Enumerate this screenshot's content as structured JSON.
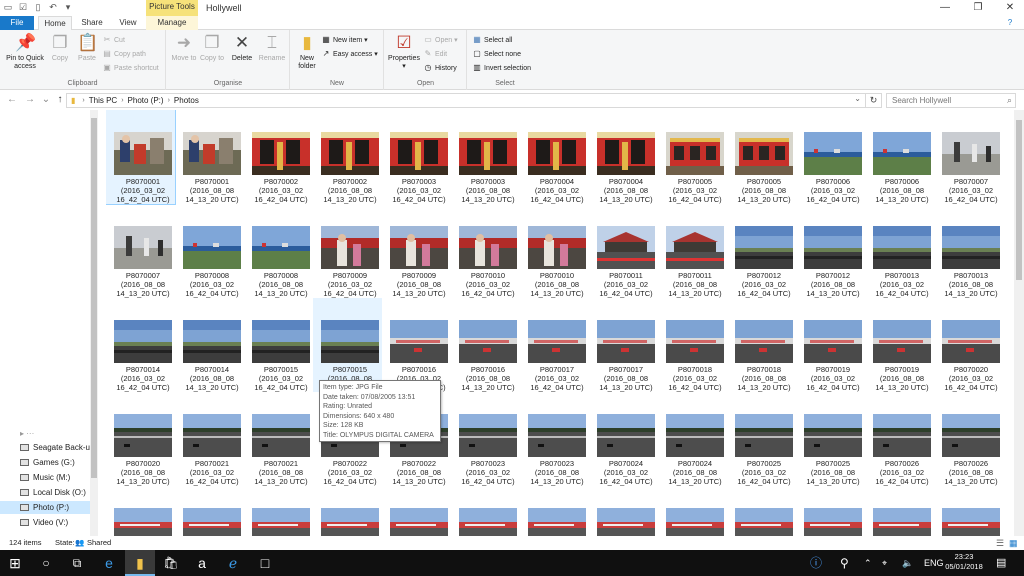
{
  "window": {
    "title": "Hollywell",
    "context_tab": "Picture Tools"
  },
  "tabs": {
    "file": "File",
    "home": "Home",
    "share": "Share",
    "view": "View",
    "manage": "Manage"
  },
  "ribbon": {
    "clipboard": {
      "label": "Clipboard",
      "pin": "Pin to Quick access",
      "copy": "Copy",
      "paste": "Paste",
      "cut": "Cut",
      "copy_path": "Copy path",
      "paste_shortcut": "Paste shortcut"
    },
    "organise": {
      "label": "Organise",
      "move_to": "Move to",
      "copy_to": "Copy to",
      "delete": "Delete",
      "rename": "Rename"
    },
    "new": {
      "label": "New",
      "new_folder": "New folder",
      "new_item": "New item",
      "easy_access": "Easy access"
    },
    "open": {
      "label": "Open",
      "properties": "Properties",
      "open": "Open",
      "edit": "Edit",
      "history": "History"
    },
    "select": {
      "label": "Select",
      "select_all": "Select all",
      "select_none": "Select none",
      "invert": "Invert selection"
    }
  },
  "address": {
    "crumbs": [
      "This PC",
      "Photo (P:)",
      "Photos"
    ],
    "search_placeholder": "Search Hollywell"
  },
  "nav": {
    "items": [
      "Seagate Back-up",
      "Games (G:)",
      "Music (M:)",
      "Local Disk (O:)",
      "Photo (P:)",
      "Video (V:)"
    ],
    "selected": 4
  },
  "files": [
    {
      "n": "P8070001",
      "d": "(2016_03_02",
      "t": "16_42_04 UTC)",
      "img": "a"
    },
    {
      "n": "P8070001",
      "d": "(2016_08_08",
      "t": "14_13_20 UTC)",
      "img": "a"
    },
    {
      "n": "P8070002",
      "d": "(2016_03_02",
      "t": "16_42_04 UTC)",
      "img": "b"
    },
    {
      "n": "P8070002",
      "d": "(2016_08_08",
      "t": "14_13_20 UTC)",
      "img": "b"
    },
    {
      "n": "P8070003",
      "d": "(2016_03_02",
      "t": "16_42_04 UTC)",
      "img": "b"
    },
    {
      "n": "P8070003",
      "d": "(2016_08_08",
      "t": "14_13_20 UTC)",
      "img": "b"
    },
    {
      "n": "P8070004",
      "d": "(2016_03_02",
      "t": "16_42_04 UTC)",
      "img": "b"
    },
    {
      "n": "P8070004",
      "d": "(2016_08_08",
      "t": "14_13_20 UTC)",
      "img": "b"
    },
    {
      "n": "P8070005",
      "d": "(2016_03_02",
      "t": "16_42_04 UTC)",
      "img": "c"
    },
    {
      "n": "P8070005",
      "d": "(2016_08_08",
      "t": "14_13_20 UTC)",
      "img": "c"
    },
    {
      "n": "P8070006",
      "d": "(2016_03_02",
      "t": "16_42_04 UTC)",
      "img": "d"
    },
    {
      "n": "P8070006",
      "d": "(2016_08_08",
      "t": "14_13_20 UTC)",
      "img": "d"
    },
    {
      "n": "P8070007",
      "d": "(2016_03_02",
      "t": "16_42_04 UTC)",
      "img": "e"
    },
    {
      "n": "P8070007",
      "d": "(2016_08_08",
      "t": "14_13_20 UTC)",
      "img": "e"
    },
    {
      "n": "P8070008",
      "d": "(2016_03_02",
      "t": "16_42_04 UTC)",
      "img": "d"
    },
    {
      "n": "P8070008",
      "d": "(2016_08_08",
      "t": "14_13_20 UTC)",
      "img": "d"
    },
    {
      "n": "P8070009",
      "d": "(2016_03_02",
      "t": "16_42_04 UTC)",
      "img": "f"
    },
    {
      "n": "P8070009",
      "d": "(2016_08_08",
      "t": "14_13_20 UTC)",
      "img": "f"
    },
    {
      "n": "P8070010",
      "d": "(2016_03_02",
      "t": "16_42_04 UTC)",
      "img": "f"
    },
    {
      "n": "P8070010",
      "d": "(2016_08_08",
      "t": "14_13_20 UTC)",
      "img": "f"
    },
    {
      "n": "P8070011",
      "d": "(2016_03_02",
      "t": "16_42_04 UTC)",
      "img": "g"
    },
    {
      "n": "P8070011",
      "d": "(2016_08_08",
      "t": "14_13_20 UTC)",
      "img": "g"
    },
    {
      "n": "P8070012",
      "d": "(2016_03_02",
      "t": "16_42_04 UTC)",
      "img": "h"
    },
    {
      "n": "P8070012",
      "d": "(2016_08_08",
      "t": "14_13_20 UTC)",
      "img": "h"
    },
    {
      "n": "P8070013",
      "d": "(2016_03_02",
      "t": "16_42_04 UTC)",
      "img": "h"
    },
    {
      "n": "P8070013",
      "d": "(2016_08_08",
      "t": "14_13_20 UTC)",
      "img": "h"
    },
    {
      "n": "P8070014",
      "d": "(2016_03_02",
      "t": "16_42_04 UTC)",
      "img": "h"
    },
    {
      "n": "P8070014",
      "d": "(2016_08_08",
      "t": "14_13_20 UTC)",
      "img": "h"
    },
    {
      "n": "P8070015",
      "d": "(2016_03_02",
      "t": "16_42_04 UTC)",
      "img": "h"
    },
    {
      "n": "P8070015",
      "d": "(2016_08_08",
      "t": "14_13_20 UTC)",
      "img": "h"
    },
    {
      "n": "P8070016",
      "d": "(2016_03_02",
      "t": "16_42_04 UTC)",
      "img": "i"
    },
    {
      "n": "P8070016",
      "d": "(2016_08_08",
      "t": "14_13_20 UTC)",
      "img": "i"
    },
    {
      "n": "P8070017",
      "d": "(2016_03_02",
      "t": "16_42_04 UTC)",
      "img": "i"
    },
    {
      "n": "P8070017",
      "d": "(2016_08_08",
      "t": "14_13_20 UTC)",
      "img": "i"
    },
    {
      "n": "P8070018",
      "d": "(2016_03_02",
      "t": "16_42_04 UTC)",
      "img": "i"
    },
    {
      "n": "P8070018",
      "d": "(2016_08_08",
      "t": "14_13_20 UTC)",
      "img": "i"
    },
    {
      "n": "P8070019",
      "d": "(2016_03_02",
      "t": "16_42_04 UTC)",
      "img": "i"
    },
    {
      "n": "P8070019",
      "d": "(2016_08_08",
      "t": "14_13_20 UTC)",
      "img": "i"
    },
    {
      "n": "P8070020",
      "d": "(2016_03_02",
      "t": "16_42_04 UTC)",
      "img": "i"
    },
    {
      "n": "P8070020",
      "d": "(2016_08_08",
      "t": "14_13_20 UTC)",
      "img": "j"
    },
    {
      "n": "P8070021",
      "d": "(2016_03_02",
      "t": "16_42_04 UTC)",
      "img": "j"
    },
    {
      "n": "P8070021",
      "d": "(2016_08_08",
      "t": "14_13_20 UTC)",
      "img": "j"
    },
    {
      "n": "P8070022",
      "d": "(2016_03_02",
      "t": "16_42_04 UTC)",
      "img": "j"
    },
    {
      "n": "P8070022",
      "d": "(2016_08_08",
      "t": "14_13_20 UTC)",
      "img": "j"
    },
    {
      "n": "P8070023",
      "d": "(2016_03_02",
      "t": "16_42_04 UTC)",
      "img": "j"
    },
    {
      "n": "P8070023",
      "d": "(2016_08_08",
      "t": "14_13_20 UTC)",
      "img": "j"
    },
    {
      "n": "P8070024",
      "d": "(2016_03_02",
      "t": "16_42_04 UTC)",
      "img": "j"
    },
    {
      "n": "P8070024",
      "d": "(2016_08_08",
      "t": "14_13_20 UTC)",
      "img": "j"
    },
    {
      "n": "P8070025",
      "d": "(2016_03_02",
      "t": "16_42_04 UTC)",
      "img": "j"
    },
    {
      "n": "P8070025",
      "d": "(2016_08_08",
      "t": "14_13_20 UTC)",
      "img": "j"
    },
    {
      "n": "P8070026",
      "d": "(2016_03_02",
      "t": "16_42_04 UTC)",
      "img": "j"
    },
    {
      "n": "P8070026",
      "d": "(2016_08_08",
      "t": "14_13_20 UTC)",
      "img": "j"
    },
    {
      "n": "",
      "d": "",
      "t": "",
      "img": "k"
    },
    {
      "n": "",
      "d": "",
      "t": "",
      "img": "k"
    },
    {
      "n": "",
      "d": "",
      "t": "",
      "img": "k"
    },
    {
      "n": "",
      "d": "",
      "t": "",
      "img": "k"
    },
    {
      "n": "",
      "d": "",
      "t": "",
      "img": "k"
    },
    {
      "n": "",
      "d": "",
      "t": "",
      "img": "k"
    },
    {
      "n": "",
      "d": "",
      "t": "",
      "img": "k"
    },
    {
      "n": "",
      "d": "",
      "t": "",
      "img": "k"
    },
    {
      "n": "",
      "d": "",
      "t": "",
      "img": "k"
    },
    {
      "n": "",
      "d": "",
      "t": "",
      "img": "k"
    },
    {
      "n": "",
      "d": "",
      "t": "",
      "img": "k"
    },
    {
      "n": "",
      "d": "",
      "t": "",
      "img": "k"
    },
    {
      "n": "",
      "d": "",
      "t": "",
      "img": "k"
    }
  ],
  "tooltip": {
    "type": "Item type: JPG File",
    "date": "Date taken: 07/08/2005 13:51",
    "rating": "Rating: Unrated",
    "dims": "Dimensions: 640 x 480",
    "size": "Size: 128 KB",
    "title": "Title: OLYMPUS DIGITAL CAMERA"
  },
  "status": {
    "count": "124 items",
    "state_label": "State:",
    "state_value": "Shared"
  },
  "taskbar": {
    "time": "23:23",
    "date": "05/01/2018",
    "lang": "ENG"
  },
  "colors": {
    "accent": "#1979ca",
    "context": "#f6e27a",
    "selection": "#cce8ff"
  }
}
